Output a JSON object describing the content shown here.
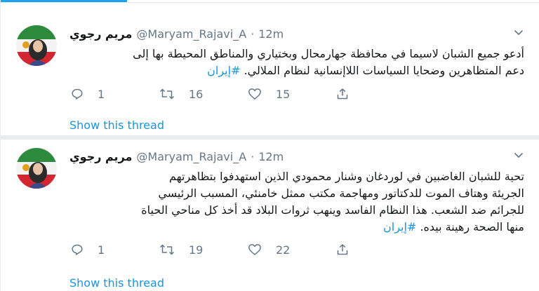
{
  "tweets": [
    {
      "author_name": "مريم رجوي",
      "handle": "@Maryam_Rajavi_A",
      "dot": "·",
      "time": "12m",
      "text_lines": [
        "أدعو جميع الشبان لاسيما في محافظة جهارمحال وبختياري والمناطق المحيطة بها إلى",
        "دعم المتظاهرين وضحايا السياسات اللاإنسانية لنظام الملالي."
      ],
      "hashtag": "#إيران",
      "replies": "1",
      "retweets": "16",
      "likes": "15",
      "show_thread": "Show this thread"
    },
    {
      "author_name": "مريم رجوي",
      "handle": "@Maryam_Rajavi_A",
      "dot": "·",
      "time": "12m",
      "text_lines": [
        "تحية للشبان الغاضبين في لوردغان وشنار محمودي الذين استهدفوا بتظاهرتهم",
        "الجريئة وهتاف الموت للدكتاتور ومهاجمة مكتب ممثل خامنئي، المسبب الرئيسي",
        "للجرائم ضد الشعب. هذا النظام الفاسد وينهب ثروات البلاد قد أخذ كل مناحي الحياة",
        "منها الصحة رهينة بيده."
      ],
      "hashtag": "#إيران",
      "replies": "1",
      "retweets": "19",
      "likes": "22",
      "show_thread": "Show this thread"
    }
  ],
  "icons": {
    "reply": "reply-icon",
    "retweet": "retweet-icon",
    "like": "heart-icon",
    "share": "share-icon",
    "caret": "chevron-down-icon",
    "avatar": "avatar"
  },
  "colors": {
    "link": "#1b95e0",
    "muted": "#657786",
    "text": "#14171a",
    "divider": "#e6ecf0",
    "accent": "#1da1f2"
  }
}
